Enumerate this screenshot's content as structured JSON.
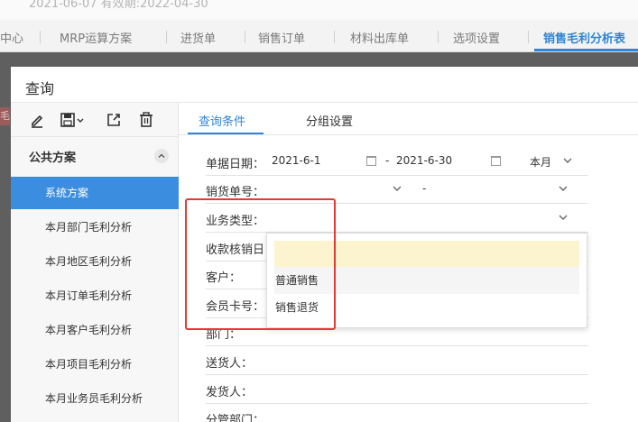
{
  "header": {
    "info_text": "2021-06-07    有效期:2022-04-30"
  },
  "tabs": [
    {
      "label": "中心"
    },
    {
      "label": "MRP运算方案"
    },
    {
      "label": "进货单"
    },
    {
      "label": "销售订单"
    },
    {
      "label": "材料出库单"
    },
    {
      "label": "选项设置"
    },
    {
      "label": "销售毛利分析表",
      "active": true
    }
  ],
  "left_mark": "毛",
  "dialog": {
    "title": "查询",
    "toolbar": {
      "icons": [
        "edit-icon",
        "save-icon",
        "export-icon",
        "delete-icon"
      ]
    },
    "sidebar": {
      "group_label": "公共方案",
      "schemes": [
        {
          "label": "系统方案",
          "active": true
        },
        {
          "label": "本月部门毛利分析"
        },
        {
          "label": "本月地区毛利分析"
        },
        {
          "label": "本月订单毛利分析"
        },
        {
          "label": "本月客户毛利分析"
        },
        {
          "label": "本月项目毛利分析"
        },
        {
          "label": "本月业务员毛利分析"
        }
      ]
    },
    "main_tabs": [
      {
        "label": "查询条件",
        "active": true
      },
      {
        "label": "分组设置"
      }
    ],
    "form": {
      "date": {
        "label": "单据日期：",
        "from": "2021-6-1",
        "sep": "-",
        "to": "2021-6-30",
        "period": "本月"
      },
      "sales_no": {
        "label": "销货单号：",
        "sep": "-"
      },
      "biz_type": {
        "label": "业务类型："
      },
      "collect_date": {
        "label": "收款核销日"
      },
      "customer": {
        "label": "客户："
      },
      "member_card": {
        "label": "会员卡号："
      },
      "department": {
        "label": "部门："
      },
      "deliverer": {
        "label": "送货人："
      },
      "shipper": {
        "label": "发货人："
      },
      "branch": {
        "label": "分管部门："
      }
    },
    "dropdown": {
      "options": [
        {
          "label": ""
        },
        {
          "label": "普通销售"
        },
        {
          "label": "销售退货"
        }
      ]
    }
  },
  "colors": {
    "accent": "#2f86d6",
    "highlight": "#fcf3cf",
    "annotation": "#e53935"
  }
}
